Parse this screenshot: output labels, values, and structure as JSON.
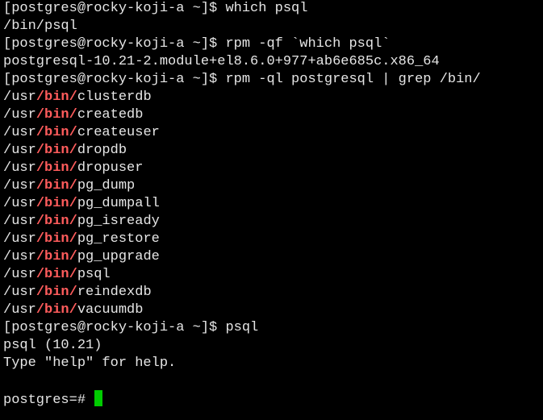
{
  "colors": {
    "background": "#000000",
    "foreground": "#e6e6e6",
    "highlight": "#ff5c5c",
    "cursor": "#00cc00"
  },
  "lines": [
    {
      "text": "[postgres@rocky-koji-a ~]$ which psql",
      "kind": "prompt-command"
    },
    {
      "text": "/bin/psql",
      "kind": "output"
    },
    {
      "text": "[postgres@rocky-koji-a ~]$ rpm -qf `which psql`",
      "kind": "prompt-command"
    },
    {
      "text": "postgresql-10.21-2.module+el8.6.0+977+ab6e685c.x86_64",
      "kind": "output"
    },
    {
      "text": "[postgres@rocky-koji-a ~]$ rpm -ql postgresql | grep /bin/",
      "kind": "prompt-command"
    },
    {
      "prefix": "/usr",
      "match": "/bin/",
      "rest": "clusterdb",
      "kind": "grep-match"
    },
    {
      "prefix": "/usr",
      "match": "/bin/",
      "rest": "createdb",
      "kind": "grep-match"
    },
    {
      "prefix": "/usr",
      "match": "/bin/",
      "rest": "createuser",
      "kind": "grep-match"
    },
    {
      "prefix": "/usr",
      "match": "/bin/",
      "rest": "dropdb",
      "kind": "grep-match"
    },
    {
      "prefix": "/usr",
      "match": "/bin/",
      "rest": "dropuser",
      "kind": "grep-match"
    },
    {
      "prefix": "/usr",
      "match": "/bin/",
      "rest": "pg_dump",
      "kind": "grep-match"
    },
    {
      "prefix": "/usr",
      "match": "/bin/",
      "rest": "pg_dumpall",
      "kind": "grep-match"
    },
    {
      "prefix": "/usr",
      "match": "/bin/",
      "rest": "pg_isready",
      "kind": "grep-match"
    },
    {
      "prefix": "/usr",
      "match": "/bin/",
      "rest": "pg_restore",
      "kind": "grep-match"
    },
    {
      "prefix": "/usr",
      "match": "/bin/",
      "rest": "pg_upgrade",
      "kind": "grep-match"
    },
    {
      "prefix": "/usr",
      "match": "/bin/",
      "rest": "psql",
      "kind": "grep-match"
    },
    {
      "prefix": "/usr",
      "match": "/bin/",
      "rest": "reindexdb",
      "kind": "grep-match"
    },
    {
      "prefix": "/usr",
      "match": "/bin/",
      "rest": "vacuumdb",
      "kind": "grep-match"
    },
    {
      "text": "[postgres@rocky-koji-a ~]$ psql",
      "kind": "prompt-command"
    },
    {
      "text": "psql (10.21)",
      "kind": "output"
    },
    {
      "text": "Type \"help\" for help.",
      "kind": "output"
    },
    {
      "text": "",
      "kind": "blank"
    },
    {
      "text": "postgres=# ",
      "kind": "active-prompt",
      "cursor": true
    }
  ]
}
